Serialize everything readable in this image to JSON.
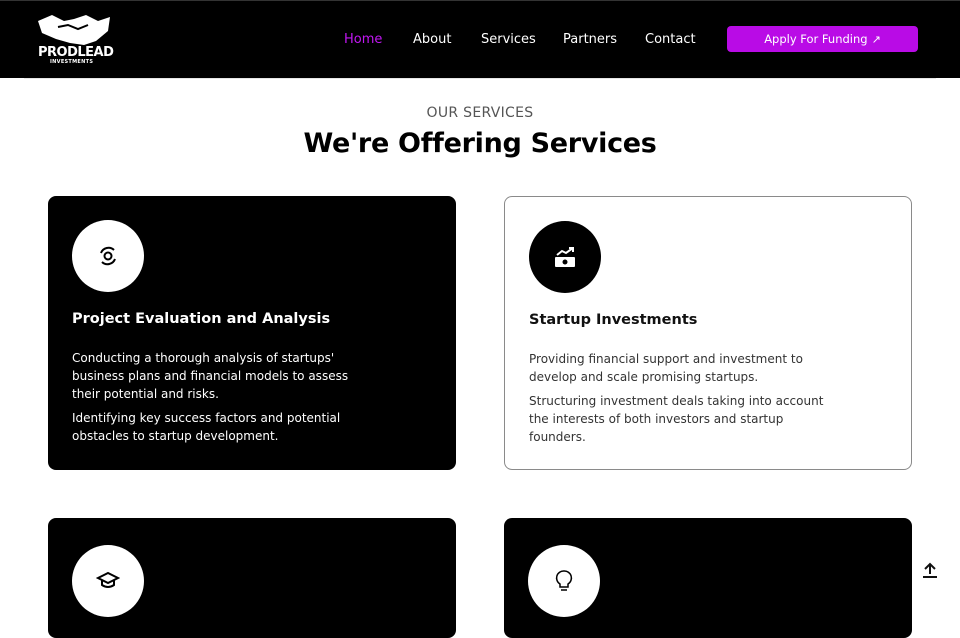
{
  "brand": {
    "name": "PRODLEAD",
    "sub": "INVESTMENTS"
  },
  "nav": {
    "links": [
      {
        "label": "Home",
        "active": true
      },
      {
        "label": "About",
        "active": false
      },
      {
        "label": "Services",
        "active": false
      },
      {
        "label": "Partners",
        "active": false
      },
      {
        "label": "Contact",
        "active": false
      }
    ],
    "cta_label": "Apply For Funding",
    "cta_arrow": "↗"
  },
  "section": {
    "eyebrow": "OUR SERVICES",
    "heading": "We're Offering Services"
  },
  "cards": [
    {
      "title": "Project Evaluation and Analysis",
      "theme": "dark",
      "icon": "analysis-icon",
      "paragraphs": [
        "Conducting a thorough analysis of startups' business plans and financial models to assess their potential and risks.",
        "Identifying key success factors and potential obstacles to startup development."
      ]
    },
    {
      "title": "Startup Investments",
      "theme": "light",
      "icon": "money-growth-icon",
      "paragraphs": [
        "Providing financial support and investment to develop and scale promising startups.",
        "Structuring investment deals taking into account the interests of both investors and startup founders."
      ]
    },
    {
      "title": "",
      "theme": "dark",
      "icon": "graduation-cap-icon",
      "paragraphs": []
    },
    {
      "title": "",
      "theme": "dark",
      "icon": "lightbulb-icon",
      "paragraphs": []
    }
  ],
  "colors": {
    "accent": "#b90be6",
    "active_link": "#c117f2",
    "dark": "#000000"
  }
}
